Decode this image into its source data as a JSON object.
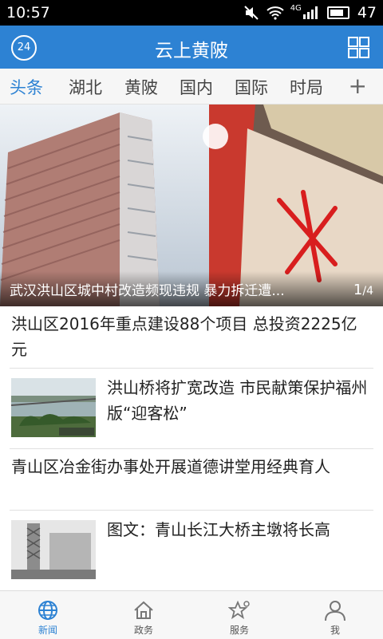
{
  "status_bar": {
    "time": "10:57",
    "network": "4G",
    "battery": "47"
  },
  "header": {
    "title": "云上黄陂",
    "logo_text": "24"
  },
  "tabs": [
    {
      "label": "头条",
      "active": true
    },
    {
      "label": "湖北"
    },
    {
      "label": "黄陂"
    },
    {
      "label": "国内"
    },
    {
      "label": "国际"
    },
    {
      "label": "时局"
    }
  ],
  "tabs_add": "+",
  "hero": {
    "caption": "武汉洪山区城中村改造频现违规 暴力拆迁遭...",
    "current": "1",
    "total": "4"
  },
  "news": [
    {
      "title": "洪山区2016年重点建设88个项目 总投资2225亿元",
      "has_thumb": false
    },
    {
      "title": "洪山桥将扩宽改造 市民献策保护福州版“迎客松”",
      "has_thumb": true
    },
    {
      "title": "青山区冶金街办事处开展道德讲堂用经典育人",
      "has_thumb": false
    },
    {
      "title": "图文：青山长江大桥主墩将长高",
      "has_thumb": true
    }
  ],
  "bottom_nav": [
    {
      "label": "新闻",
      "icon": "globe-icon",
      "active": true
    },
    {
      "label": "政务",
      "icon": "home-icon"
    },
    {
      "label": "服务",
      "icon": "star-icon"
    },
    {
      "label": "我",
      "icon": "person-icon"
    }
  ],
  "colors": {
    "accent": "#2d82d3",
    "status_bar": "#000000"
  }
}
